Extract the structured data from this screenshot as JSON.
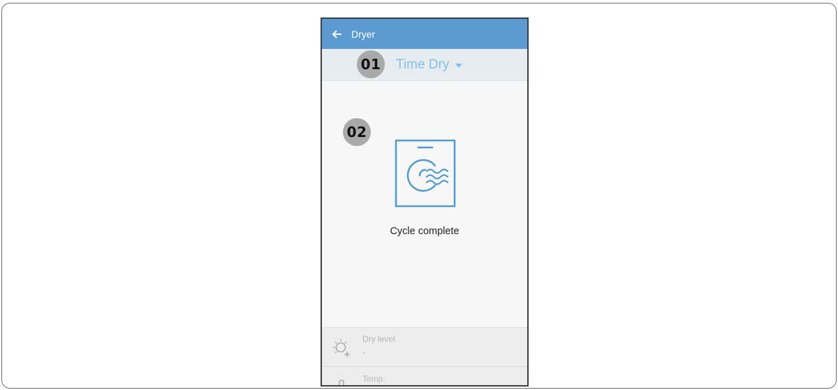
{
  "app": {
    "title": "Dryer"
  },
  "mode": {
    "selected": "Time Dry"
  },
  "badges": {
    "first": "01",
    "second": "02"
  },
  "status": {
    "text": "Cycle complete"
  },
  "settings": {
    "dry_level": {
      "label": "Dry level",
      "value": "-"
    },
    "temp": {
      "label": "Temp."
    }
  },
  "colors": {
    "appbar": "#5b9bd1",
    "accent": "#7fc1e8",
    "icon_stroke": "#4f9bd0",
    "badge": "#a9a9a9"
  },
  "icons": {
    "back": "arrow-left-icon",
    "dropdown": "caret-down-icon",
    "status": "dryer-icon",
    "dry_level": "sun-plus-icon",
    "temp": "thermometer-icon"
  }
}
